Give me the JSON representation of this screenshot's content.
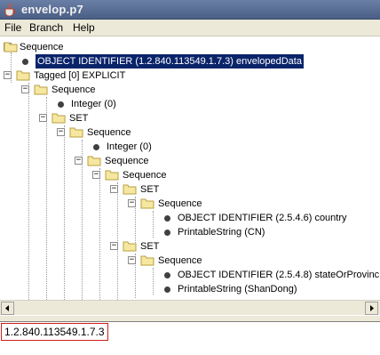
{
  "window": {
    "title": "envelop.p7",
    "icon": "java-cup-icon"
  },
  "menu": {
    "items": [
      "File",
      "Branch",
      "Help"
    ]
  },
  "tree": {
    "nodes": [
      {
        "label": "Sequence",
        "type": "folder",
        "expanded": true
      },
      {
        "label": "OBJECT IDENTIFIER (1.2.840.113549.1.7.3) envelopedData",
        "type": "leaf",
        "selected": true
      },
      {
        "label": "Tagged [0] EXPLICIT",
        "type": "folder",
        "expanded": true
      },
      {
        "label": "Sequence",
        "type": "folder",
        "expanded": true
      },
      {
        "label": "Integer (0)",
        "type": "leaf"
      },
      {
        "label": "SET",
        "type": "folder",
        "expanded": true
      },
      {
        "label": "Sequence",
        "type": "folder",
        "expanded": true
      },
      {
        "label": "Integer (0)",
        "type": "leaf"
      },
      {
        "label": "Sequence",
        "type": "folder",
        "expanded": true
      },
      {
        "label": "Sequence",
        "type": "folder",
        "expanded": true
      },
      {
        "label": "SET",
        "type": "folder",
        "expanded": true
      },
      {
        "label": "Sequence",
        "type": "folder",
        "expanded": true
      },
      {
        "label": "OBJECT IDENTIFIER (2.5.4.6) country",
        "type": "leaf"
      },
      {
        "label": "PrintableString (CN)",
        "type": "leaf"
      },
      {
        "label": "SET",
        "type": "folder",
        "expanded": true
      },
      {
        "label": "Sequence",
        "type": "folder",
        "expanded": true
      },
      {
        "label": "OBJECT IDENTIFIER (2.5.4.8) stateOrProvinc",
        "type": "leaf"
      },
      {
        "label": "PrintableString (ShanDong)",
        "type": "leaf"
      }
    ]
  },
  "detail": {
    "value": "1.2.840.113549.1.7.3"
  },
  "colors": {
    "selection": "#0a246a",
    "highlight_border": "#d02020",
    "title_bar": "#5a6f96"
  }
}
